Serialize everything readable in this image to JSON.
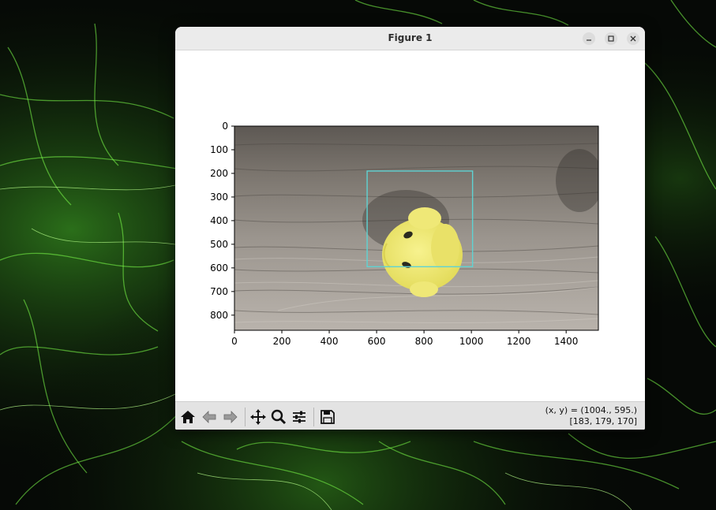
{
  "window": {
    "title": "Figure 1",
    "controls": {
      "minimize_icon": "minimize-icon",
      "maximize_icon": "maximize-icon",
      "close_icon": "close-icon"
    }
  },
  "figure": {
    "image_description_visible": false,
    "xticks": [
      "0",
      "200",
      "400",
      "600",
      "800",
      "1000",
      "1200",
      "1400"
    ],
    "yticks": [
      "0",
      "100",
      "200",
      "300",
      "400",
      "500",
      "600",
      "700",
      "800"
    ],
    "xlim": [
      0,
      1536
    ],
    "ylim": [
      864,
      0
    ],
    "bounding_box": {
      "x1": 560,
      "y1": 190,
      "x2": 1005,
      "y2": 595,
      "color": "#5fd3d3"
    }
  },
  "toolbar": {
    "buttons": [
      {
        "name": "home-button",
        "icon": "home-icon"
      },
      {
        "name": "back-button",
        "icon": "back-arrow-icon"
      },
      {
        "name": "forward-button",
        "icon": "forward-arrow-icon"
      },
      {
        "name": "pan-button",
        "icon": "pan-icon"
      },
      {
        "name": "zoom-button",
        "icon": "zoom-icon"
      },
      {
        "name": "configure-subplots-button",
        "icon": "sliders-icon"
      },
      {
        "name": "save-button",
        "icon": "save-icon"
      }
    ],
    "coords_line1": "(x, y) = (1004., 595.)",
    "coords_line2": "[183, 179, 170]"
  },
  "colors": {
    "toolbar_bg": "#e3e3e3",
    "titlebar_bg": "#ebebeb",
    "bbox": "#5fd3d3",
    "duck": "#f2ec7a"
  }
}
